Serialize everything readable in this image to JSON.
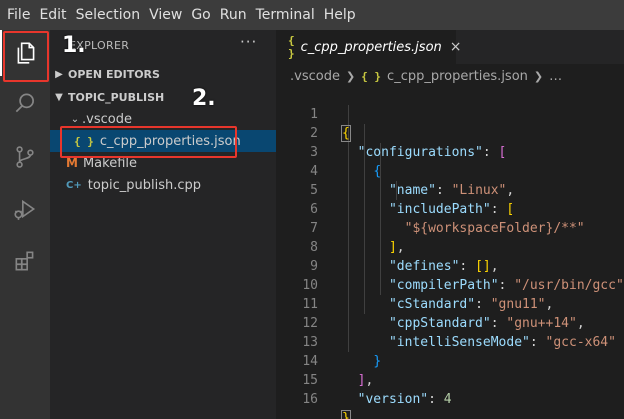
{
  "menubar": {
    "items": [
      "File",
      "Edit",
      "Selection",
      "View",
      "Go",
      "Run",
      "Terminal",
      "Help"
    ]
  },
  "activitybar": {
    "icons": [
      "files-icon",
      "search-icon",
      "source-control-icon",
      "run-debug-icon",
      "extensions-icon"
    ]
  },
  "sidebar": {
    "title": "EXPLORER",
    "more": "···",
    "open_editors": "OPEN EDITORS",
    "project": "TOPIC_PUBLISH",
    "tree": {
      "folder": ".vscode",
      "json_file": "c_cpp_properties.json",
      "makefile": "Makefile",
      "cpp_file": "topic_publish.cpp"
    },
    "json_icon": "{ }",
    "makefile_icon": "M",
    "cpp_icon": "C+"
  },
  "editor": {
    "tab": {
      "icon": "{ }",
      "label": "c_cpp_properties.json",
      "close": "×"
    },
    "breadcrumb": [
      ".vscode",
      "c_cpp_properties.json",
      "…"
    ],
    "breadcrumb_icon": "{ }",
    "line_numbers": [
      "1",
      "2",
      "3",
      "4",
      "5",
      "6",
      "7",
      "8",
      "9",
      "10",
      "11",
      "12",
      "13",
      "14",
      "15",
      "16"
    ],
    "code": {
      "configurations_key": "\"configurations\"",
      "name_key": "\"name\"",
      "name_val": "\"Linux\"",
      "include_key": "\"includePath\"",
      "include_val": "\"${workspaceFolder}/**\"",
      "defines_key": "\"defines\"",
      "defines_val": "[]",
      "compiler_key": "\"compilerPath\"",
      "compiler_val": "\"/usr/bin/gcc\"",
      "cstd_key": "\"cStandard\"",
      "cstd_val": "\"gnu11\"",
      "cppstd_key": "\"cppStandard\"",
      "cppstd_val": "\"gnu++14\"",
      "intelli_key": "\"intelliSenseMode\"",
      "intelli_val": "\"gcc-x64\"",
      "version_key": "\"version\"",
      "version_val": "4"
    }
  },
  "annotations": {
    "step1": "1.",
    "step2": "2."
  },
  "colors": {
    "annotation_red": "#e8362c",
    "selection": "#094771",
    "json_icon": "#cbcb41"
  }
}
